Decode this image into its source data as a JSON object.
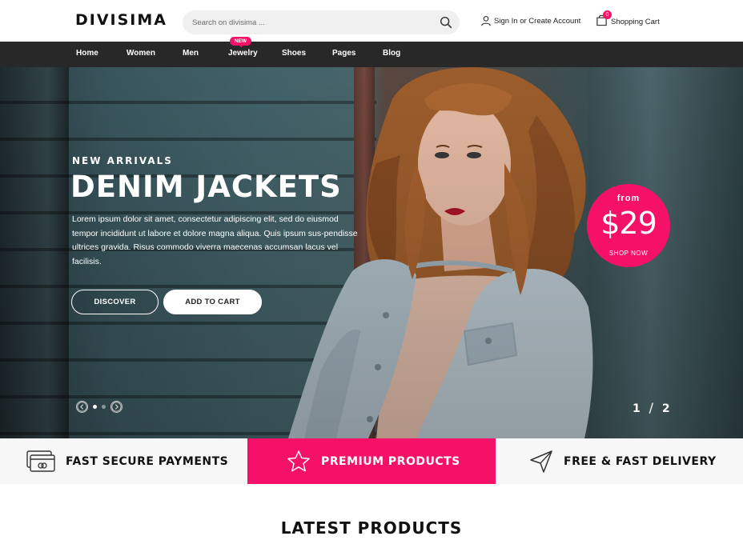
{
  "header": {
    "logo": "DIVISIMA",
    "search_placeholder": "Search on divisima ...",
    "account_label": "Sign In or Create Account",
    "cart_label": "Shopping Cart",
    "cart_count": "0"
  },
  "nav": {
    "items": [
      "Home",
      "Women",
      "Men",
      "Jewelry",
      "Shoes",
      "Pages",
      "Blog"
    ],
    "new_badge": "NEW"
  },
  "hero": {
    "kicker": "NEW ARRIVALS",
    "headline": "DENIM JACKETS",
    "description": "Lorem ipsum dolor sit amet, consectetur adipiscing elit, sed do eiusmod tempor incididunt ut labore et dolore magna aliqua. Quis ipsum sus-pendisse ultrices gravida. Risus commodo viverra maecenas accumsan lacus vel facilisis.",
    "discover_label": "DISCOVER",
    "add_to_cart_label": "ADD TO CART",
    "promo_from": "from",
    "promo_price": "$29",
    "promo_shop": "SHOP NOW",
    "slide_current": "1",
    "slide_total": "2"
  },
  "features": {
    "items": [
      "FAST SECURE PAYMENTS",
      "PREMIUM PRODUCTS",
      "FREE & FAST DELIVERY"
    ]
  },
  "section_title": "LATEST PRODUCTS",
  "colors": {
    "accent": "#f51167",
    "nav_bg": "#282828",
    "feature_bg": "#f7f7f7"
  }
}
